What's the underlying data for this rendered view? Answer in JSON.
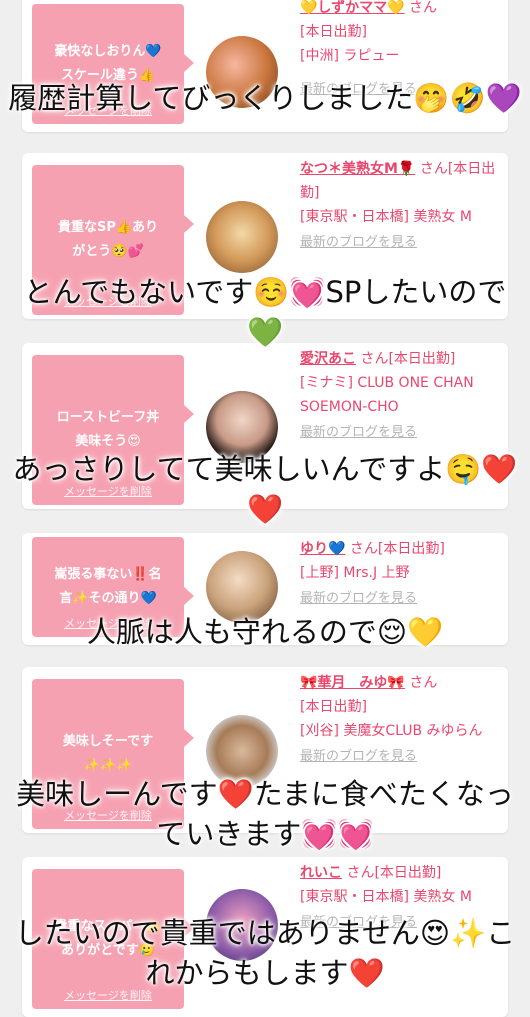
{
  "cards": [
    {
      "message": "豪快なしおりん💙\nスケール違う👍",
      "delete_label": "メッセージを削除",
      "name": "💛しずかママ💛",
      "san": "さん",
      "status": "[本日出勤]",
      "shop": "[中洲] ラピュー",
      "blog": "最新のブログを見る"
    },
    {
      "message": "貴重なSP👍あり\nがとう🥺💕",
      "delete_label": "メッセージを削除",
      "name": "なつ＊美熟女M🌹",
      "san": "さん[本日出勤]",
      "status": "",
      "shop": "[東京駅・日本橋] 美熟女 M",
      "blog": "最新のブログを見る"
    },
    {
      "message": "ローストビーフ丼\n美味そう😍",
      "delete_label": "メッセージを削除",
      "name": "愛沢あこ",
      "san": "さん[本日出勤]",
      "status": "",
      "shop": "[ミナミ] CLUB ONE CHAN SOEMON-CHO",
      "blog": "最新のブログを見る"
    },
    {
      "message": "嵩張る事ない‼️名\n言✨その通り💙",
      "delete_label": "メッセージを削除",
      "name": "ゆり💙",
      "san": "さん[本日出勤]",
      "status": "",
      "shop": "[上野] Mrs.J 上野",
      "blog": "最新のブログを見る"
    },
    {
      "message": "美味しそーです\n✨✨✨",
      "delete_label": "メッセージを削除",
      "name": "🎀華月　みゆ🎀",
      "san": "さん",
      "status": "[本日出勤]",
      "shop": "[刈谷] 美魔女CLUB みゆらん",
      "blog": "最新のブログを見る"
    },
    {
      "message": "貴重なスーパー👍\nありがとです🥲",
      "delete_label": "メッセージを削除",
      "name": "れいこ",
      "san": "さん[本日出勤]",
      "status": "",
      "shop": "[東京駅・日本橋] 美熟女 M",
      "blog": "最新のブログを見る"
    }
  ],
  "captions": [
    "履歴計算してびっくりしました🤭🤣💜",
    "とんでもないです☺️💓SPしたいので💚",
    "あっさりしてて美味しいんですよ🤤❤️❤️",
    "人脈は人も守れるので😌💛",
    "美味しーんです❤️たまに食べたくなっていきます💓💓",
    "したいので貴重ではありません😍✨これからもします❤️"
  ],
  "colors": {
    "bubble": "#f6a1b1",
    "name": "#e8486e",
    "background": "#efefef"
  }
}
